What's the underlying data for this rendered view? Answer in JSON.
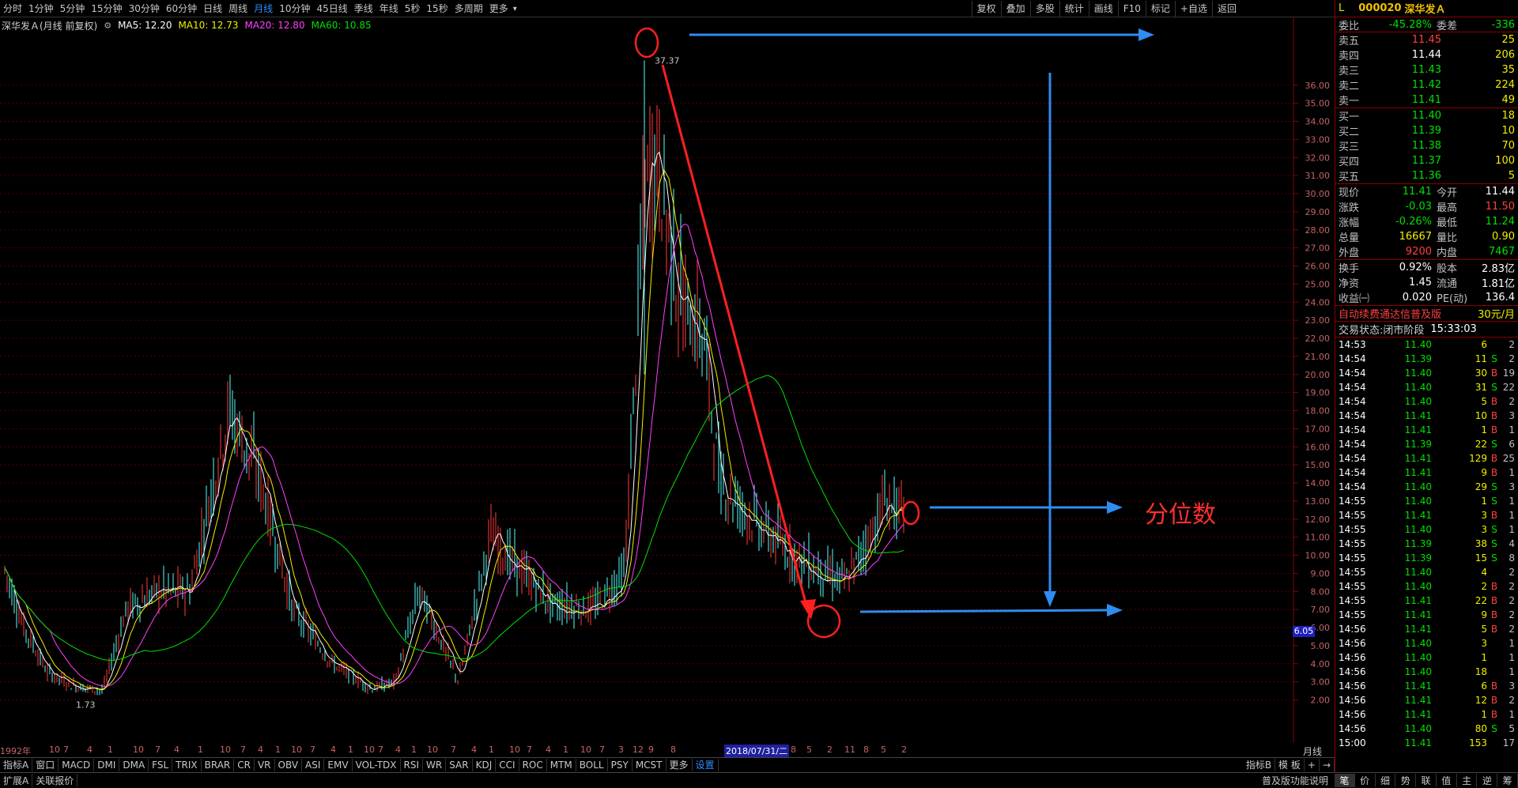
{
  "toolbar": {
    "timeframes": [
      "分时",
      "1分钟",
      "5分钟",
      "15分钟",
      "30分钟",
      "60分钟",
      "日线",
      "周线",
      "月线",
      "10分钟",
      "45日线",
      "季线",
      "年线",
      "5秒",
      "15秒",
      "多周期",
      "更多"
    ],
    "active_timeframe": "月线",
    "right_tools": [
      "复权",
      "叠加",
      "多股",
      "统计",
      "画线",
      "F10",
      "标记",
      "+自选",
      "返回"
    ]
  },
  "chart_info": {
    "title": "深华发Ａ(月线 前复权)",
    "ma5": "MA5: 12.20",
    "ma10": "MA10: 12.73",
    "ma20": "MA20: 12.80",
    "ma60": "MA60: 10.85",
    "colors": {
      "ma5": "#ffffff",
      "ma10": "#f0f000",
      "ma20": "#ff40ff",
      "ma60": "#00e000"
    }
  },
  "chart": {
    "y_ticks": [
      "36.00",
      "35.00",
      "34.00",
      "33.00",
      "32.00",
      "31.00",
      "30.00",
      "29.00",
      "28.00",
      "27.00",
      "26.00",
      "25.00",
      "24.00",
      "23.00",
      "22.00",
      "21.00",
      "20.00",
      "19.00",
      "18.00",
      "17.00",
      "16.00",
      "15.00",
      "14.00",
      "13.00",
      "12.00",
      "11.00",
      "10.00",
      "9.00",
      "8.00",
      "7.00",
      "6.00",
      "5.00",
      "4.00",
      "3.00",
      "2.00"
    ],
    "high_label": "37.37",
    "low_label": "1.73",
    "current_marker": "6.05",
    "annotation_text": "分位数",
    "period": "月线",
    "date_labels": [
      "1992年",
      "10",
      "7",
      "4",
      "1",
      "10",
      "7",
      "4",
      "1",
      "10",
      "7",
      "4",
      "1",
      "10",
      "7",
      "4",
      "1",
      "10",
      "7",
      "4",
      "1",
      "10",
      "7",
      "4",
      "1",
      "10",
      "7",
      "4",
      "1",
      "10",
      "7",
      "3",
      "12",
      "9",
      "8",
      "2018/07/31/二",
      "8",
      "5",
      "2",
      "11",
      "8",
      "5",
      "2"
    ]
  },
  "quote": {
    "code": "000020",
    "name": "深华发Ａ",
    "level": "L",
    "weibi": {
      "label": "委比",
      "value": "-45.28%",
      "label2": "委差",
      "value2": "-336"
    },
    "sells": [
      {
        "label": "卖五",
        "price": "11.45",
        "vol": "25"
      },
      {
        "label": "卖四",
        "price": "11.44",
        "vol": "206"
      },
      {
        "label": "卖三",
        "price": "11.43",
        "vol": "35"
      },
      {
        "label": "卖二",
        "price": "11.42",
        "vol": "224"
      },
      {
        "label": "卖一",
        "price": "11.41",
        "vol": "49"
      }
    ],
    "buys": [
      {
        "label": "买一",
        "price": "11.40",
        "vol": "18"
      },
      {
        "label": "买二",
        "price": "11.39",
        "vol": "10"
      },
      {
        "label": "买三",
        "price": "11.38",
        "vol": "70"
      },
      {
        "label": "买四",
        "price": "11.37",
        "vol": "100"
      },
      {
        "label": "买五",
        "price": "11.36",
        "vol": "5"
      }
    ],
    "stats": [
      {
        "l1": "现价",
        "v1": "11.41",
        "c1": "green",
        "l2": "今开",
        "v2": "11.44",
        "c2": "white"
      },
      {
        "l1": "涨跌",
        "v1": "-0.03",
        "c1": "green",
        "l2": "最高",
        "v2": "11.50",
        "c2": "red"
      },
      {
        "l1": "涨幅",
        "v1": "-0.26%",
        "c1": "green",
        "l2": "最低",
        "v2": "11.24",
        "c2": "green"
      },
      {
        "l1": "总量",
        "v1": "16667",
        "c1": "yellow",
        "l2": "量比",
        "v2": "0.90",
        "c2": "yellow"
      },
      {
        "l1": "外盘",
        "v1": "9200",
        "c1": "red",
        "l2": "内盘",
        "v2": "7467",
        "c2": "green"
      }
    ],
    "stats2": [
      {
        "l1": "换手",
        "v1": "0.92%",
        "l2": "股本",
        "v2": "2.83亿"
      },
      {
        "l1": "净资",
        "v1": "1.45",
        "l2": "流通",
        "v2": "1.81亿"
      },
      {
        "l1": "收益㈠",
        "v1": "0.020",
        "l2": "PE(动)",
        "v2": "136.4"
      }
    ],
    "ad": {
      "text": "自动续费通达信普及版",
      "price": "30元/月"
    },
    "state": {
      "text": "交易状态:闭市阶段",
      "time": "15:33:03"
    },
    "ticks": [
      {
        "t": "14:53",
        "p": "11.40",
        "v": "6",
        "bs": "",
        "n": "2"
      },
      {
        "t": "14:54",
        "p": "11.39",
        "v": "11",
        "bs": "S",
        "n": "2"
      },
      {
        "t": "14:54",
        "p": "11.40",
        "v": "30",
        "bs": "B",
        "n": "19"
      },
      {
        "t": "14:54",
        "p": "11.40",
        "v": "31",
        "bs": "S",
        "n": "22"
      },
      {
        "t": "14:54",
        "p": "11.40",
        "v": "5",
        "bs": "B",
        "n": "2"
      },
      {
        "t": "14:54",
        "p": "11.41",
        "v": "10",
        "bs": "B",
        "n": "3"
      },
      {
        "t": "14:54",
        "p": "11.41",
        "v": "1",
        "bs": "B",
        "n": "1"
      },
      {
        "t": "14:54",
        "p": "11.39",
        "v": "22",
        "bs": "S",
        "n": "6"
      },
      {
        "t": "14:54",
        "p": "11.41",
        "v": "129",
        "bs": "B",
        "n": "25"
      },
      {
        "t": "14:54",
        "p": "11.41",
        "v": "9",
        "bs": "B",
        "n": "1"
      },
      {
        "t": "14:54",
        "p": "11.40",
        "v": "29",
        "bs": "S",
        "n": "3"
      },
      {
        "t": "14:55",
        "p": "11.40",
        "v": "1",
        "bs": "S",
        "n": "1"
      },
      {
        "t": "14:55",
        "p": "11.41",
        "v": "3",
        "bs": "B",
        "n": "1"
      },
      {
        "t": "14:55",
        "p": "11.40",
        "v": "3",
        "bs": "S",
        "n": "1"
      },
      {
        "t": "14:55",
        "p": "11.39",
        "v": "38",
        "bs": "S",
        "n": "4"
      },
      {
        "t": "14:55",
        "p": "11.39",
        "v": "15",
        "bs": "S",
        "n": "8"
      },
      {
        "t": "14:55",
        "p": "11.40",
        "v": "4",
        "bs": "",
        "n": "2"
      },
      {
        "t": "14:55",
        "p": "11.40",
        "v": "2",
        "bs": "B",
        "n": "2"
      },
      {
        "t": "14:55",
        "p": "11.41",
        "v": "22",
        "bs": "B",
        "n": "2"
      },
      {
        "t": "14:55",
        "p": "11.41",
        "v": "9",
        "bs": "B",
        "n": "2"
      },
      {
        "t": "14:56",
        "p": "11.41",
        "v": "5",
        "bs": "B",
        "n": "2"
      },
      {
        "t": "14:56",
        "p": "11.40",
        "v": "3",
        "bs": "",
        "n": "1"
      },
      {
        "t": "14:56",
        "p": "11.40",
        "v": "1",
        "bs": "",
        "n": "1"
      },
      {
        "t": "14:56",
        "p": "11.40",
        "v": "18",
        "bs": "",
        "n": "1"
      },
      {
        "t": "14:56",
        "p": "11.41",
        "v": "6",
        "bs": "B",
        "n": "3"
      },
      {
        "t": "14:56",
        "p": "11.41",
        "v": "12",
        "bs": "B",
        "n": "2"
      },
      {
        "t": "14:56",
        "p": "11.41",
        "v": "1",
        "bs": "B",
        "n": "1"
      },
      {
        "t": "14:56",
        "p": "11.40",
        "v": "80",
        "bs": "S",
        "n": "5"
      },
      {
        "t": "15:00",
        "p": "11.41",
        "v": "153",
        "bs": "",
        "n": "17"
      }
    ]
  },
  "indicator_tabs": [
    "指标A",
    "窗口",
    "MACD",
    "DMI",
    "DMA",
    "FSL",
    "TRIX",
    "BRAR",
    "CR",
    "VR",
    "OBV",
    "ASI",
    "EMV",
    "VOL-TDX",
    "RSI",
    "WR",
    "SAR",
    "KDJ",
    "CCI",
    "ROC",
    "MTM",
    "BOLL",
    "PSY",
    "MCST",
    "更多",
    "设置"
  ],
  "indicator_selected": "设置",
  "indicator_right": [
    "指标B",
    "模 板",
    "+",
    "→"
  ],
  "ext_tabs": [
    "扩展A",
    "关联报价"
  ],
  "ext_right": "普及版功能说明",
  "quote_tabs": [
    "笔",
    "价",
    "细",
    "势",
    "联",
    "值",
    "主",
    "逆",
    "筹"
  ],
  "quote_tab_selected": "笔"
}
